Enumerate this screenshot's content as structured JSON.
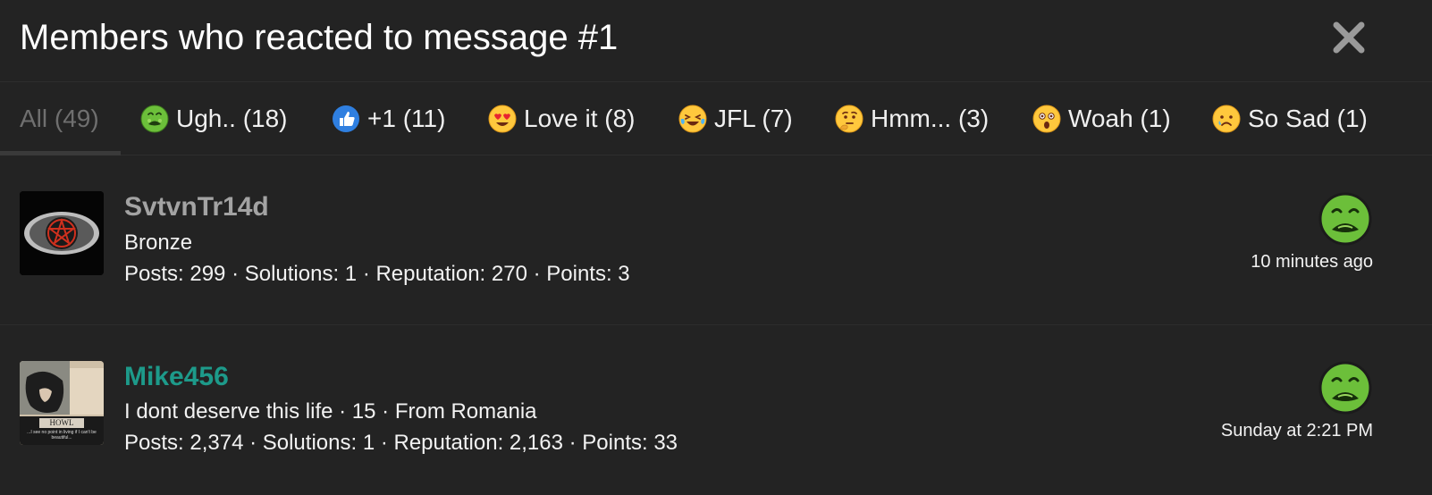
{
  "header": {
    "title": "Members who reacted to message #1"
  },
  "tabs": [
    {
      "label": "All (49)",
      "icon": ""
    },
    {
      "label": "Ugh.. (18)",
      "icon": "nauseated-face-icon"
    },
    {
      "label": "+1 (11)",
      "icon": "thumbs-up-icon"
    },
    {
      "label": "Love it (8)",
      "icon": "heart-eyes-icon"
    },
    {
      "label": "JFL (7)",
      "icon": "crying-laughing-icon"
    },
    {
      "label": "Hmm... (3)",
      "icon": "thinking-face-icon"
    },
    {
      "label": "Woah (1)",
      "icon": "astonished-face-icon"
    },
    {
      "label": "So Sad (1)",
      "icon": "sad-face-icon"
    }
  ],
  "members": [
    {
      "username": "SvtvnTr14d",
      "username_color": "#a3a3a3",
      "user_title": "Bronze",
      "stats": "Posts: 299 · Solutions: 1 · Reputation: 270 · Points: 3",
      "reaction_icon": "nauseated-face-icon",
      "time": "10 minutes ago"
    },
    {
      "username": "Mike456",
      "username_color": "#1d9a8a",
      "user_title": "I dont deserve this life · 15 · From Romania",
      "stats": "Posts: 2,374 · Solutions: 1 · Reputation: 2,163 · Points: 33",
      "reaction_icon": "nauseated-face-icon",
      "time": "Sunday at 2:21 PM",
      "avatar_caption": "HOWL",
      "avatar_subcaption": "...I see no point in living if I can't be beautiful..."
    }
  ],
  "colors": {
    "background": "#232323",
    "nausea_green": "#6cbf3a"
  }
}
